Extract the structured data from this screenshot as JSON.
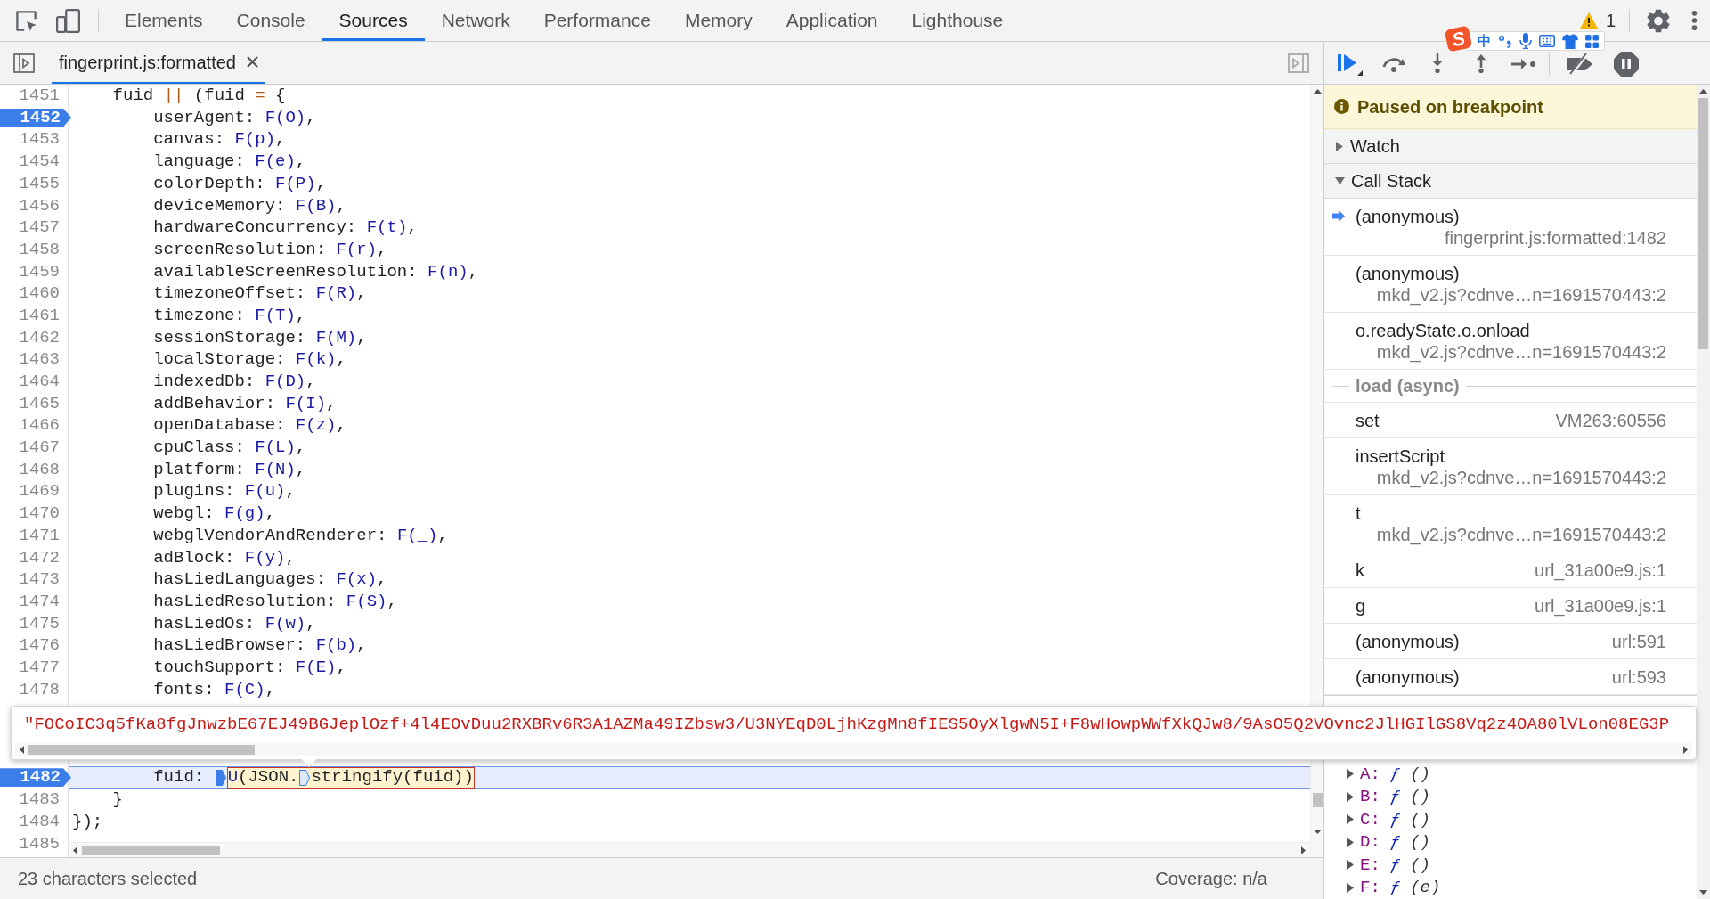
{
  "toolbar": {
    "tabs": [
      {
        "label": "Elements",
        "selected": false
      },
      {
        "label": "Console",
        "selected": false
      },
      {
        "label": "Sources",
        "selected": true
      },
      {
        "label": "Network",
        "selected": false
      },
      {
        "label": "Performance",
        "selected": false
      },
      {
        "label": "Memory",
        "selected": false
      },
      {
        "label": "Application",
        "selected": false
      },
      {
        "label": "Lighthouse",
        "selected": false
      }
    ],
    "warnings": {
      "count": "1"
    }
  },
  "ime_toolbar": {
    "logo": "S",
    "mode": "中"
  },
  "editor": {
    "file_tab": {
      "label": "fingerprint.js:formatted",
      "selected": true
    },
    "lines_above_popup": [
      {
        "number": "1451",
        "breakpoint": false,
        "paused": false,
        "tokens": [
          {
            "kind": "plain",
            "text": "    fuid "
          },
          {
            "kind": "operator",
            "text": "||"
          },
          {
            "kind": "plain",
            "text": " (fuid "
          },
          {
            "kind": "operator",
            "text": "="
          },
          {
            "kind": "plain",
            "text": " {"
          }
        ]
      },
      {
        "number": "1452",
        "breakpoint": true,
        "paused": false,
        "tokens": [
          {
            "kind": "plain",
            "text": "        userAgent: "
          },
          {
            "kind": "value",
            "text": "F(O)"
          },
          {
            "kind": "plain",
            "text": ","
          }
        ]
      },
      {
        "number": "1453",
        "breakpoint": false,
        "paused": false,
        "tokens": [
          {
            "kind": "plain",
            "text": "        canvas: "
          },
          {
            "kind": "value",
            "text": "F(p)"
          },
          {
            "kind": "plain",
            "text": ","
          }
        ]
      },
      {
        "number": "1454",
        "breakpoint": false,
        "paused": false,
        "tokens": [
          {
            "kind": "plain",
            "text": "        language: "
          },
          {
            "kind": "value",
            "text": "F(e)"
          },
          {
            "kind": "plain",
            "text": ","
          }
        ]
      },
      {
        "number": "1455",
        "breakpoint": false,
        "paused": false,
        "tokens": [
          {
            "kind": "plain",
            "text": "        colorDepth: "
          },
          {
            "kind": "value",
            "text": "F(P)"
          },
          {
            "kind": "plain",
            "text": ","
          }
        ]
      },
      {
        "number": "1456",
        "breakpoint": false,
        "paused": false,
        "tokens": [
          {
            "kind": "plain",
            "text": "        deviceMemory: "
          },
          {
            "kind": "value",
            "text": "F(B)"
          },
          {
            "kind": "plain",
            "text": ","
          }
        ]
      },
      {
        "number": "1457",
        "breakpoint": false,
        "paused": false,
        "tokens": [
          {
            "kind": "plain",
            "text": "        hardwareConcurrency: "
          },
          {
            "kind": "value",
            "text": "F(t)"
          },
          {
            "kind": "plain",
            "text": ","
          }
        ]
      },
      {
        "number": "1458",
        "breakpoint": false,
        "paused": false,
        "tokens": [
          {
            "kind": "plain",
            "text": "        screenResolution: "
          },
          {
            "kind": "value",
            "text": "F(r)"
          },
          {
            "kind": "plain",
            "text": ","
          }
        ]
      },
      {
        "number": "1459",
        "breakpoint": false,
        "paused": false,
        "tokens": [
          {
            "kind": "plain",
            "text": "        availableScreenResolution: "
          },
          {
            "kind": "value",
            "text": "F(n)"
          },
          {
            "kind": "plain",
            "text": ","
          }
        ]
      },
      {
        "number": "1460",
        "breakpoint": false,
        "paused": false,
        "tokens": [
          {
            "kind": "plain",
            "text": "        timezoneOffset: "
          },
          {
            "kind": "value",
            "text": "F(R)"
          },
          {
            "kind": "plain",
            "text": ","
          }
        ]
      },
      {
        "number": "1461",
        "breakpoint": false,
        "paused": false,
        "tokens": [
          {
            "kind": "plain",
            "text": "        timezone: "
          },
          {
            "kind": "value",
            "text": "F(T)"
          },
          {
            "kind": "plain",
            "text": ","
          }
        ]
      },
      {
        "number": "1462",
        "breakpoint": false,
        "paused": false,
        "tokens": [
          {
            "kind": "plain",
            "text": "        sessionStorage: "
          },
          {
            "kind": "value",
            "text": "F(M)"
          },
          {
            "kind": "plain",
            "text": ","
          }
        ]
      },
      {
        "number": "1463",
        "breakpoint": false,
        "paused": false,
        "tokens": [
          {
            "kind": "plain",
            "text": "        localStorage: "
          },
          {
            "kind": "value",
            "text": "F(k)"
          },
          {
            "kind": "plain",
            "text": ","
          }
        ]
      },
      {
        "number": "1464",
        "breakpoint": false,
        "paused": false,
        "tokens": [
          {
            "kind": "plain",
            "text": "        indexedDb: "
          },
          {
            "kind": "value",
            "text": "F(D)"
          },
          {
            "kind": "plain",
            "text": ","
          }
        ]
      },
      {
        "number": "1465",
        "breakpoint": false,
        "paused": false,
        "tokens": [
          {
            "kind": "plain",
            "text": "        addBehavior: "
          },
          {
            "kind": "value",
            "text": "F(I)"
          },
          {
            "kind": "plain",
            "text": ","
          }
        ]
      },
      {
        "number": "1466",
        "breakpoint": false,
        "paused": false,
        "tokens": [
          {
            "kind": "plain",
            "text": "        openDatabase: "
          },
          {
            "kind": "value",
            "text": "F(z)"
          },
          {
            "kind": "plain",
            "text": ","
          }
        ]
      },
      {
        "number": "1467",
        "breakpoint": false,
        "paused": false,
        "tokens": [
          {
            "kind": "plain",
            "text": "        cpuClass: "
          },
          {
            "kind": "value",
            "text": "F(L)"
          },
          {
            "kind": "plain",
            "text": ","
          }
        ]
      },
      {
        "number": "1468",
        "breakpoint": false,
        "paused": false,
        "tokens": [
          {
            "kind": "plain",
            "text": "        platform: "
          },
          {
            "kind": "value",
            "text": "F(N)"
          },
          {
            "kind": "plain",
            "text": ","
          }
        ]
      },
      {
        "number": "1469",
        "breakpoint": false,
        "paused": false,
        "tokens": [
          {
            "kind": "plain",
            "text": "        plugins: "
          },
          {
            "kind": "value",
            "text": "F(u)"
          },
          {
            "kind": "plain",
            "text": ","
          }
        ]
      },
      {
        "number": "1470",
        "breakpoint": false,
        "paused": false,
        "tokens": [
          {
            "kind": "plain",
            "text": "        webgl: "
          },
          {
            "kind": "value",
            "text": "F(g)"
          },
          {
            "kind": "plain",
            "text": ","
          }
        ]
      },
      {
        "number": "1471",
        "breakpoint": false,
        "paused": false,
        "tokens": [
          {
            "kind": "plain",
            "text": "        webglVendorAndRenderer: "
          },
          {
            "kind": "value",
            "text": "F(_)"
          },
          {
            "kind": "plain",
            "text": ","
          }
        ]
      },
      {
        "number": "1472",
        "breakpoint": false,
        "paused": false,
        "tokens": [
          {
            "kind": "plain",
            "text": "        adBlock: "
          },
          {
            "kind": "value",
            "text": "F(y)"
          },
          {
            "kind": "plain",
            "text": ","
          }
        ]
      },
      {
        "number": "1473",
        "breakpoint": false,
        "paused": false,
        "tokens": [
          {
            "kind": "plain",
            "text": "        hasLiedLanguages: "
          },
          {
            "kind": "value",
            "text": "F(x)"
          },
          {
            "kind": "plain",
            "text": ","
          }
        ]
      },
      {
        "number": "1474",
        "breakpoint": false,
        "paused": false,
        "tokens": [
          {
            "kind": "plain",
            "text": "        hasLiedResolution: "
          },
          {
            "kind": "value",
            "text": "F(S)"
          },
          {
            "kind": "plain",
            "text": ","
          }
        ]
      },
      {
        "number": "1475",
        "breakpoint": false,
        "paused": false,
        "tokens": [
          {
            "kind": "plain",
            "text": "        hasLiedOs: "
          },
          {
            "kind": "value",
            "text": "F(w)"
          },
          {
            "kind": "plain",
            "text": ","
          }
        ]
      },
      {
        "number": "1476",
        "breakpoint": false,
        "paused": false,
        "tokens": [
          {
            "kind": "plain",
            "text": "        hasLiedBrowser: "
          },
          {
            "kind": "value",
            "text": "F(b)"
          },
          {
            "kind": "plain",
            "text": ","
          }
        ]
      },
      {
        "number": "1477",
        "breakpoint": false,
        "paused": false,
        "tokens": [
          {
            "kind": "plain",
            "text": "        touchSupport: "
          },
          {
            "kind": "value",
            "text": "F(E)"
          },
          {
            "kind": "plain",
            "text": ","
          }
        ]
      },
      {
        "number": "1478",
        "breakpoint": false,
        "paused": false,
        "tokens": [
          {
            "kind": "plain",
            "text": "        fonts: "
          },
          {
            "kind": "value",
            "text": "F(C)"
          },
          {
            "kind": "plain",
            "text": ","
          }
        ]
      }
    ],
    "lines_below_popup": [
      {
        "number": "1482",
        "breakpoint": true,
        "paused": true,
        "tokens": [
          {
            "kind": "plain",
            "text": "        fuid: "
          },
          {
            "kind": "inline_breakpoint",
            "active": true
          },
          {
            "kind": "selection",
            "tokens": [
              {
                "kind": "value",
                "text": "U"
              },
              {
                "kind": "plain",
                "text": "(JSON."
              },
              {
                "kind": "inline_breakpoint",
                "active": false
              },
              {
                "kind": "plain",
                "text": "stringify(fuid))"
              }
            ]
          }
        ]
      },
      {
        "number": "1483",
        "breakpoint": false,
        "paused": false,
        "tokens": [
          {
            "kind": "plain",
            "text": "    }"
          }
        ]
      },
      {
        "number": "1484",
        "breakpoint": false,
        "paused": false,
        "tokens": [
          {
            "kind": "plain",
            "text": "});"
          }
        ]
      },
      {
        "number": "1485",
        "breakpoint": false,
        "paused": false
      }
    ]
  },
  "status_bar": {
    "selection": "23 characters selected",
    "coverage": "Coverage: n/a"
  },
  "value_popup": {
    "value": "\"FOCoIC3q5fKa8fgJnwzbE67EJ49BGJeplOzf+4l4EOvDuu2RXBRv6R3A1AZMa49IZbsw3/U3NYEqD0LjhKzgMn8fIES5OyXlgwN5I+F8wHowpWWfXkQJw8/9AsO5Q2VOvnc2JlHGIlGS8Vq2z4OA80lVLon08EG3P"
  },
  "debugger": {
    "banner": {
      "message": "Paused on breakpoint"
    },
    "watch": {
      "title": "Watch",
      "expanded": false
    },
    "call_stack": {
      "title": "Call Stack",
      "expanded": true,
      "frames": [
        {
          "kind": "frame",
          "name": "(anonymous)",
          "location": "fingerprint.js:formatted:1482",
          "selected": true
        },
        {
          "kind": "frame",
          "name": "(anonymous)",
          "location": "mkd_v2.js?cdnve…n=1691570443:2",
          "selected": false
        },
        {
          "kind": "frame",
          "name": "o.readyState.o.onload",
          "location": "mkd_v2.js?cdnve…n=1691570443:2",
          "selected": false
        },
        {
          "kind": "async",
          "label": "load (async)"
        },
        {
          "kind": "frame",
          "name": "set",
          "location": "VM263:60556",
          "selected": false
        },
        {
          "kind": "frame",
          "name": "insertScript",
          "location": "mkd_v2.js?cdnve…n=1691570443:2",
          "selected": false
        },
        {
          "kind": "frame",
          "name": "t",
          "location": "mkd_v2.js?cdnve…n=1691570443:2",
          "selected": false
        },
        {
          "kind": "frame",
          "name": "k",
          "location": "url_31a00e9.js:1",
          "selected": false
        },
        {
          "kind": "frame",
          "name": "g",
          "location": "url_31a00e9.js:1",
          "selected": false
        },
        {
          "kind": "frame",
          "name": "(anonymous)",
          "location": "url:591",
          "selected": false
        },
        {
          "kind": "frame",
          "name": "(anonymous)",
          "location": "url:593",
          "selected": false
        }
      ]
    },
    "scope": {
      "items": [
        {
          "name": "A:",
          "symbol": "ƒ",
          "params": "()",
          "expanded": false
        },
        {
          "name": "B:",
          "symbol": "ƒ",
          "params": "()",
          "expanded": false
        },
        {
          "name": "C:",
          "symbol": "ƒ",
          "params": "()",
          "expanded": false
        },
        {
          "name": "D:",
          "symbol": "ƒ",
          "params": "()",
          "expanded": false
        },
        {
          "name": "E:",
          "symbol": "ƒ",
          "params": "()",
          "expanded": false
        },
        {
          "name": "F:",
          "symbol": "ƒ",
          "params": "(e)",
          "expanded": false
        }
      ]
    }
  }
}
